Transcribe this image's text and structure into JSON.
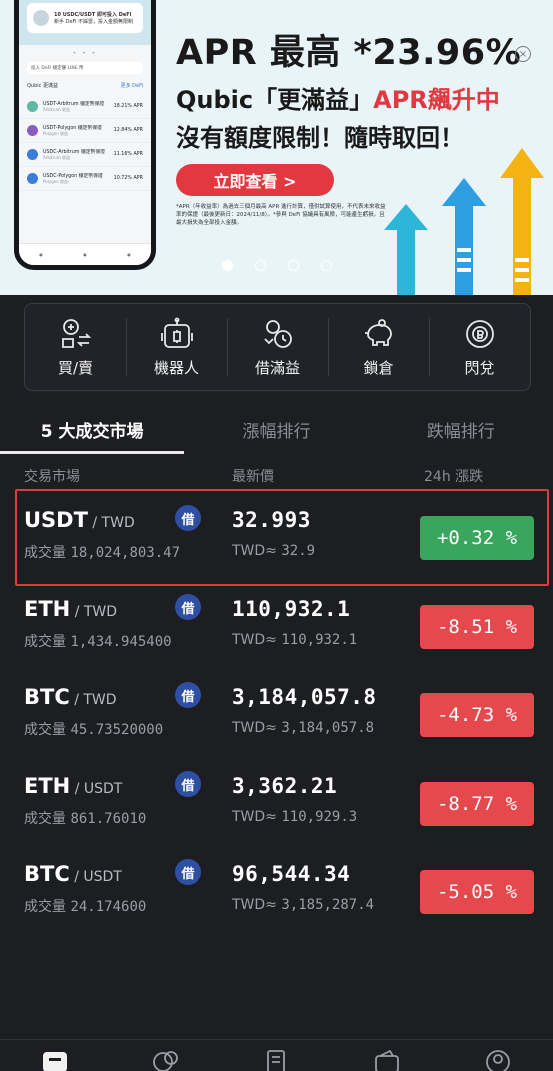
{
  "banner": {
    "title": "APR 最高 *23.96%",
    "subtitle_prefix": "Qubic「更滿益」",
    "subtitle_highlight": "APR飆升中",
    "subtitle2": "沒有額度限制！隨時取回！",
    "cta_label": "立即查看 >",
    "note": "*APR（年收益率）為過去三個月最高 APR 進行計算，僅供試算使用，不代表未來收益率的保證（最後更新日：2024/11/8）。*參與 DeFi 協議具有風險，可能產生虧損，且最大損失為全部投入金額。",
    "phone": {
      "top_text": "10 USDC/USDT 即可投入 DeFi",
      "top_sub": "新手 DeFi 不踩雷，投入金額無限制",
      "bar_text": "投入 DeFi 穩定賺 LINE 幣",
      "section_title": "Qubic 更滿益",
      "section_link": "更多 DeFi",
      "products": [
        {
          "name": "USDT-Arbitrum 穩定幣保證",
          "sub": "Arbitrum 收益",
          "apr": "18.21% APR"
        },
        {
          "name": "USDT-Polygon 穩定幣保證",
          "sub": "Polygon 收益",
          "apr": "12.84% APR"
        },
        {
          "name": "USDC-Arbitrum 穩定幣保證",
          "sub": "Arbitrum 收益",
          "apr": "11.16% APR"
        },
        {
          "name": "USDC-Polygon 穩定幣保證",
          "sub": "Polygon 收益",
          "apr": "10.72% APR"
        }
      ]
    }
  },
  "quick_menu": [
    {
      "label": "買/賣",
      "icon": "buy-sell-icon"
    },
    {
      "label": "機器人",
      "icon": "robot-icon"
    },
    {
      "label": "借滿益",
      "icon": "loan-icon"
    },
    {
      "label": "鎖倉",
      "icon": "piggy-bank-icon"
    },
    {
      "label": "閃兌",
      "icon": "swap-icon"
    }
  ],
  "tabs": [
    {
      "label": "5 大成交市場",
      "active": true
    },
    {
      "label": "漲幅排行",
      "active": false
    },
    {
      "label": "跌幅排行",
      "active": false
    }
  ],
  "columns": {
    "market": "交易市場",
    "price": "最新價",
    "change": "24h 漲跌"
  },
  "markets": [
    {
      "base": "USDT",
      "quote": " / TWD",
      "borrow": "借",
      "volume_label": "成交量",
      "volume": "18,024,803.47",
      "price": "32.993",
      "twd_label": "TWD≈",
      "twd": "32.9",
      "change": "+0.32 %",
      "direction": "up"
    },
    {
      "base": "ETH",
      "quote": " / TWD",
      "borrow": "借",
      "volume_label": "成交量",
      "volume": "1,434.945400",
      "price": "110,932.1",
      "twd_label": "TWD≈",
      "twd": "110,932.1",
      "change": "-8.51 %",
      "direction": "down"
    },
    {
      "base": "BTC",
      "quote": " / TWD",
      "borrow": "借",
      "volume_label": "成交量",
      "volume": "45.73520000",
      "price": "3,184,057.8",
      "twd_label": "TWD≈",
      "twd": "3,184,057.8",
      "change": "-4.73 %",
      "direction": "down"
    },
    {
      "base": "ETH",
      "quote": " / USDT",
      "borrow": "借",
      "volume_label": "成交量",
      "volume": "861.76010",
      "price": "3,362.21",
      "twd_label": "TWD≈",
      "twd": "110,929.3",
      "change": "-8.77 %",
      "direction": "down"
    },
    {
      "base": "BTC",
      "quote": " / USDT",
      "borrow": "借",
      "volume_label": "成交量",
      "volume": "24.174600",
      "price": "96,544.34",
      "twd_label": "TWD≈",
      "twd": "3,185,287.4",
      "change": "-5.05 %",
      "direction": "down"
    }
  ],
  "colors": {
    "up": "#3aa55c",
    "down": "#e5484d",
    "accent": "#e2383f",
    "highlight": "#e03a3a"
  },
  "bottom_nav": [
    "exchange-icon",
    "bot-icon",
    "orders-icon",
    "wallet-icon",
    "profile-icon"
  ]
}
